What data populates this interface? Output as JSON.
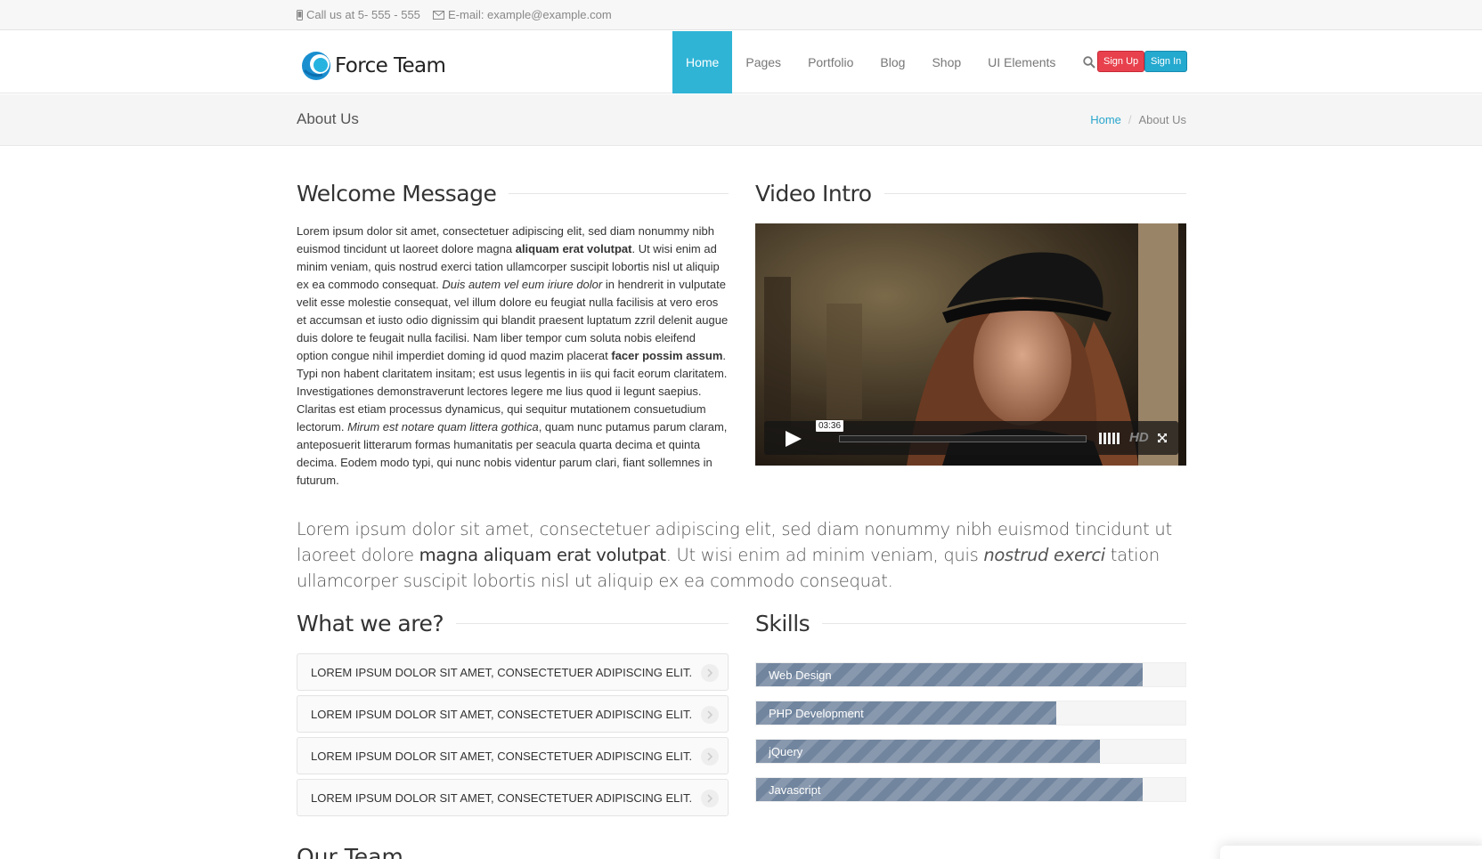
{
  "topbar": {
    "phone": "Call us at 5- 555 - 555",
    "email": "E-mail: example@example.com"
  },
  "brand": {
    "name": "Force Team",
    "accent": "#2fb4d6"
  },
  "nav": {
    "items": [
      "Home",
      "Pages",
      "Portfolio",
      "Blog",
      "Shop",
      "UI Elements"
    ],
    "active": "Home",
    "signup": "Sign Up",
    "signin": "Sign In"
  },
  "page": {
    "title": "About Us",
    "breadcrumb": [
      "Home",
      "About Us"
    ]
  },
  "welcome": {
    "title": "Welcome Message",
    "p1": "Lorem ipsum dolor sit amet, consectetuer adipiscing elit, sed diam nonummy nibh euismod tincidunt ut laoreet dolore magna ",
    "b1": "aliquam erat volutpat",
    "p2": ". Ut wisi enim ad minim veniam, quis nostrud exerci tation ullamcorper suscipit lobortis nisl ut aliquip ex ea commodo consequat. ",
    "i1": "Duis autem vel eum iriure dolor",
    "p3": " in hendrerit in vulputate velit esse molestie consequat, vel illum dolore eu feugiat nulla facilisis at vero eros et accumsan et iusto odio dignissim qui blandit praesent luptatum zzril delenit augue duis dolore te feugait nulla facilisi. Nam liber tempor cum soluta nobis eleifend option congue nihil imperdiet doming id quod mazim placerat ",
    "b2": "facer possim assum",
    "p4": ". Typi non habent claritatem insitam; est usus legentis in iis qui facit eorum claritatem. Investigationes demonstraverunt lectores legere me lius quod ii legunt saepius. Claritas est etiam processus dynamicus, qui sequitur mutationem consuetudium lectorum. ",
    "i2": "Mirum est notare quam littera gothica",
    "p5": ", quam nunc putamus parum claram, anteposuerit litterarum formas humanitatis per seacula quarta decima et quinta decima. Eodem modo typi, qui nunc nobis videntur parum clari, fiant sollemnes in futurum."
  },
  "video": {
    "title": "Video Intro",
    "time": "03:36",
    "hd": "HD"
  },
  "lead": {
    "p1": "Lorem ipsum dolor sit amet, consectetuer adipiscing elit, sed diam nonummy nibh euismod tincidunt ut laoreet dolore ",
    "b1": "magna aliquam erat volutpat",
    "p2": ". Ut wisi enim ad minim veniam, quis ",
    "i1": "nostrud exerci",
    "p3": " tation ullamcorper suscipit lobortis nisl ut aliquip ex ea commodo consequat."
  },
  "whatwe": {
    "title": "What we are?",
    "items": [
      "LOREM IPSUM DOLOR SIT AMET, CONSECTETUER ADIPISCING ELIT.",
      "LOREM IPSUM DOLOR SIT AMET, CONSECTETUER ADIPISCING ELIT.",
      "LOREM IPSUM DOLOR SIT AMET, CONSECTETUER ADIPISCING ELIT.",
      "LOREM IPSUM DOLOR SIT AMET, CONSECTETUER ADIPISCING ELIT."
    ]
  },
  "skills": {
    "title": "Skills",
    "items": [
      {
        "label": "Web Design",
        "percent": 90
      },
      {
        "label": "PHP Development",
        "percent": 70
      },
      {
        "label": "jQuery",
        "percent": 80
      },
      {
        "label": "Javascript",
        "percent": 90
      }
    ],
    "bar_color": "#71859e"
  },
  "next_section": "Our Team"
}
